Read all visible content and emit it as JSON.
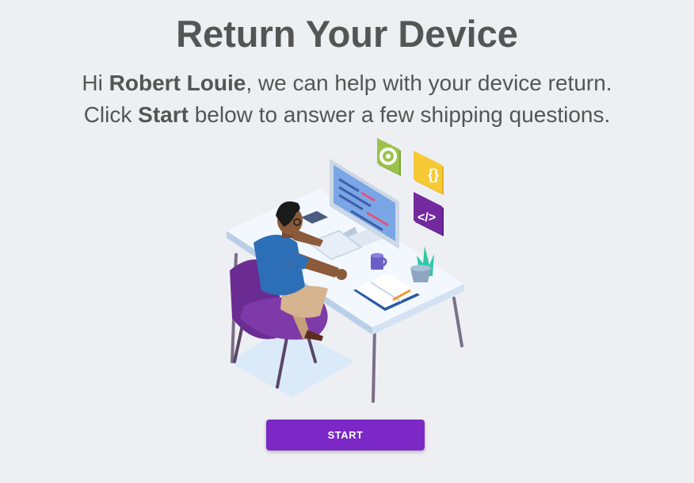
{
  "heading": "Return Your Device",
  "intro": {
    "greeting": "Hi",
    "user_name": "Robert Louie",
    "line1_rest": ", we can help with your device return.",
    "line2_prefix": "Click",
    "line2_bold": "Start",
    "line2_rest": "below to answer a few shipping questions."
  },
  "start_button": {
    "label": "START"
  },
  "colors": {
    "accent": "#7b28c6",
    "text": "#555555",
    "background": "#eeeff3"
  },
  "illustration": {
    "name": "person-working-at-desk-illustration",
    "icons": [
      "gear-icon",
      "curly-braces-icon",
      "code-icon"
    ]
  }
}
